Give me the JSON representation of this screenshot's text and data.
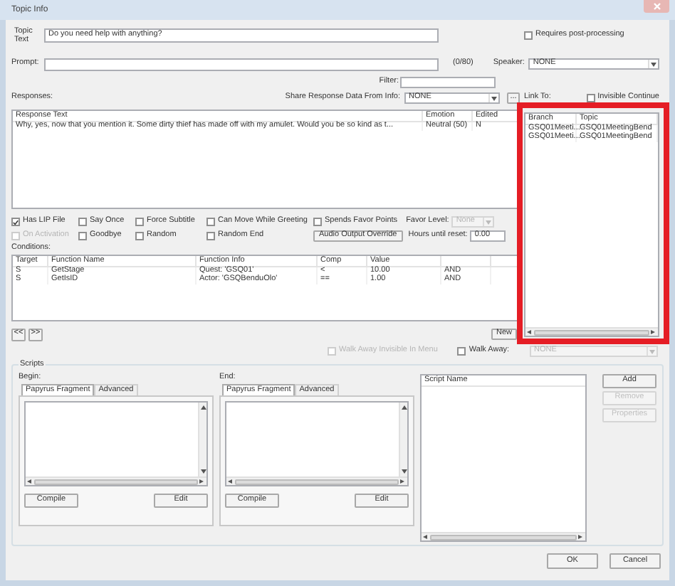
{
  "window": {
    "title": "Topic Info"
  },
  "topic_text": {
    "label": "Topic Text",
    "value": "Do you need help with anything?"
  },
  "requires_post_processing": {
    "label": "Requires post-processing",
    "checked": false
  },
  "prompt": {
    "label": "Prompt:",
    "counter": "(0/80)"
  },
  "speaker": {
    "label": "Speaker:",
    "value": "NONE"
  },
  "filter": {
    "label": "Filter:"
  },
  "responses": {
    "label": "Responses:",
    "share_label": "Share Response Data From Info:",
    "share_value": "NONE",
    "more_button": "..."
  },
  "link_to": {
    "label": "Link To:",
    "invisible_continue": {
      "label": "Invisible Continue",
      "checked": false
    }
  },
  "response_table": {
    "columns": [
      "Response Text",
      "Emotion",
      "Edited"
    ],
    "rows": [
      [
        "Why, yes, now that you mention it. Some dirty thief has made off with my amulet. Would you be so kind as t...",
        "Neutral (50)",
        "N"
      ]
    ]
  },
  "link_list": {
    "columns": [
      "Branch",
      "Topic"
    ],
    "rows": [
      [
        "GSQ01Meeti...",
        "GSQ01MeetingBend"
      ],
      [
        "GSQ01Meeti...",
        "GSQ01MeetingBend"
      ]
    ]
  },
  "option_rows": [
    [
      {
        "label": "Has LIP File",
        "checked": true,
        "disabled": false
      },
      {
        "label": "Say Once",
        "checked": false,
        "disabled": false
      },
      {
        "label": "Force Subtitle",
        "checked": false,
        "disabled": false
      },
      {
        "label": "Can Move While Greeting",
        "checked": false,
        "disabled": false
      },
      {
        "label": "Spends Favor Points",
        "checked": false,
        "disabled": false
      }
    ],
    [
      {
        "label": "On Activation",
        "checked": false,
        "disabled": true
      },
      {
        "label": "Goodbye",
        "checked": false,
        "disabled": false
      },
      {
        "label": "Random",
        "checked": false,
        "disabled": false
      },
      {
        "label": "Random End",
        "checked": false,
        "disabled": false
      }
    ]
  ],
  "favor_level": {
    "label": "Favor Level:",
    "value": "None",
    "disabled": true
  },
  "audio_output_override": "Audio Output Override",
  "hours_until_reset": {
    "label": "Hours until reset:",
    "value": "0.00"
  },
  "conditions": {
    "label": "Conditions:",
    "columns": [
      "Target",
      "Function Name",
      "Function Info",
      "Comp",
      "Value"
    ],
    "rows": [
      [
        "S",
        "GetStage",
        "Quest: 'GSQ01'",
        "<",
        "10.00",
        "AND"
      ],
      [
        "S",
        "GetIsID",
        "Actor: 'GSQBenduOlo'",
        "==",
        "1.00",
        "AND"
      ]
    ]
  },
  "nav_buttons": [
    "<<",
    ">>"
  ],
  "new_button": "New",
  "walk_away_invisible": {
    "label": "Walk Away Invisible In Menu",
    "checked": false,
    "disabled": true
  },
  "walk_away": {
    "label": "Walk Away:",
    "checked": false
  },
  "walk_away_topic": {
    "value": "NONE",
    "disabled": true
  },
  "scripts": {
    "title": "Scripts",
    "panels": [
      {
        "label": "Begin:",
        "tabs": [
          {
            "label": "Papyrus Fragment",
            "selected": true
          },
          {
            "label": "Advanced",
            "selected": false
          }
        ],
        "buttons": [
          "Compile",
          "Edit"
        ]
      },
      {
        "label": "End:",
        "tabs": [
          {
            "label": "Papyrus Fragment",
            "selected": true
          },
          {
            "label": "Advanced",
            "selected": false
          }
        ],
        "buttons": [
          "Compile",
          "Edit"
        ]
      }
    ],
    "script_list": {
      "columns": [
        "Script Name"
      ]
    },
    "buttons": [
      {
        "label": "Add",
        "disabled": false
      },
      {
        "label": "Remove",
        "disabled": true
      },
      {
        "label": "Properties",
        "disabled": true
      }
    ]
  },
  "dialog_buttons": [
    "OK",
    "Cancel"
  ]
}
